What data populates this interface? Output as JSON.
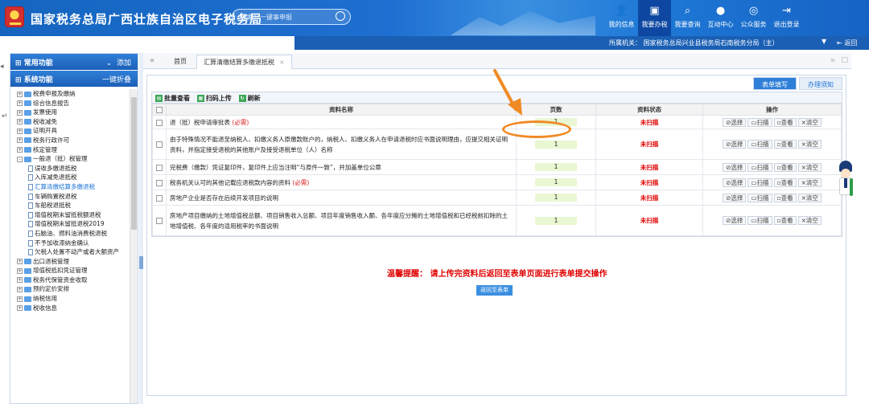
{
  "header": {
    "title": "国家税务总局广西壮族自治区电子税务局",
    "search_placeholder": "搜索：一键事申报",
    "nav": [
      {
        "label": "我的信息",
        "icon": "user-icon"
      },
      {
        "label": "我要办税",
        "icon": "monitor-icon"
      },
      {
        "label": "我要查询",
        "icon": "doc-search-icon"
      },
      {
        "label": "互动中心",
        "icon": "chat-icon"
      },
      {
        "label": "公众服务",
        "icon": "service-icon"
      },
      {
        "label": "退出登录",
        "icon": "logout-icon"
      }
    ]
  },
  "subheader": {
    "org": "所属机关：  国家税务总局兴业县税务局石南税务分局（主）",
    "dropdown": "▼",
    "back": "返回"
  },
  "sidebar": {
    "common": "常用功能",
    "common_add": "添加",
    "system": "系统功能",
    "system_action": "一键折叠",
    "items": [
      {
        "label": "税费申报及缴纳",
        "level": 1,
        "type": "folder",
        "pm": "+"
      },
      {
        "label": "综合信息报告",
        "level": 1,
        "type": "folder",
        "pm": "+"
      },
      {
        "label": "发票使用",
        "level": 1,
        "type": "folder",
        "pm": "+"
      },
      {
        "label": "税收减免",
        "level": 1,
        "type": "folder",
        "pm": "+"
      },
      {
        "label": "证明开具",
        "level": 1,
        "type": "folder",
        "pm": "+"
      },
      {
        "label": "税务行政许可",
        "level": 1,
        "type": "folder",
        "pm": "+"
      },
      {
        "label": "核定管理",
        "level": 1,
        "type": "folder",
        "pm": "+"
      },
      {
        "label": "一般退（抵）税管理",
        "level": 1,
        "type": "folder",
        "pm": "-"
      },
      {
        "label": "误收多缴退抵税",
        "level": 2,
        "type": "page"
      },
      {
        "label": "入库减免退抵税",
        "level": 2,
        "type": "page"
      },
      {
        "label": "汇算清缴结算多缴退税",
        "level": 2,
        "type": "page",
        "selected": true
      },
      {
        "label": "车辆购置税退税",
        "level": 2,
        "type": "page"
      },
      {
        "label": "车船税退抵税",
        "level": 2,
        "type": "page"
      },
      {
        "label": "增值税期末留抵税额退税",
        "level": 2,
        "type": "page"
      },
      {
        "label": "增值税期末留抵退税2019",
        "level": 2,
        "type": "page"
      },
      {
        "label": "石脑油、燃料油消费税退税",
        "level": 2,
        "type": "page"
      },
      {
        "label": "不予加收滞纳金确认",
        "level": 2,
        "type": "page"
      },
      {
        "label": "欠税人处置不动产或者大额资产",
        "level": 2,
        "type": "page"
      },
      {
        "label": "出口退税管理",
        "level": 1,
        "type": "folder",
        "pm": "+"
      },
      {
        "label": "增值税抵扣凭证管理",
        "level": 1,
        "type": "folder",
        "pm": "+"
      },
      {
        "label": "税务代保管资金收取",
        "level": 1,
        "type": "folder",
        "pm": "+"
      },
      {
        "label": "预约定价安排",
        "level": 1,
        "type": "folder",
        "pm": "+"
      },
      {
        "label": "纳税信用",
        "level": 1,
        "type": "folder",
        "pm": "+"
      },
      {
        "label": "税收信息",
        "level": 1,
        "type": "folder",
        "pm": "+"
      }
    ]
  },
  "tabs": {
    "home": "首页",
    "current": "汇算清缴结算多缴退抵税",
    "close": "×"
  },
  "panel_tabs": {
    "fill": "表单填写",
    "notice": "办理须知"
  },
  "toolbar": {
    "batch_view": "批量查看",
    "scan_upload": "扫码上传",
    "refresh": "刷新"
  },
  "table": {
    "headers": {
      "name": "资料名称",
      "pages": "页数",
      "status": "资料状态",
      "op": "操作"
    },
    "op_buttons": {
      "choose": "选择",
      "scan": "扫描",
      "view": "查看",
      "clear": "清空"
    },
    "rows": [
      {
        "name": "退（抵）税申请审批表",
        "required": "(必需)",
        "pages": "1",
        "status": "未扫描"
      },
      {
        "name": "由于特殊情况不能退至纳税人、扣缴义务人原缴款账户的，纳税人、扣缴义务人在申请退税时应书面说明理由，应提交相关证明资料，并指定接受退税的其他账户及接受退税单位（人）名称",
        "required": "",
        "pages": "1",
        "status": "未扫描"
      },
      {
        "name": "完税费（缴款）凭证复印件，复印件上应当注明“与原件一致”，并加盖单位公章",
        "required": "",
        "pages": "1",
        "status": "未扫描"
      },
      {
        "name": "税务机关认可的其他记载应退税款内容的资料",
        "required": "(必需)",
        "pages": "1",
        "status": "未扫描"
      },
      {
        "name": "房地产企业是否存在后续开发项目的说明",
        "required": "",
        "pages": "1",
        "status": "未扫描"
      },
      {
        "name": "房地产项目缴纳的土地增值税总额、项目销售收入总额、项目年度销售收入额、各年度应分摊的土地增值税和已经税前扣除的土地增值税、各年度的适用税率的书面说明",
        "required": "",
        "pages": "1",
        "status": "未扫描"
      }
    ]
  },
  "tip": "温馨提醒：  请上传完资料后返回至表单页面进行表单提交操作",
  "return_button": "返回至表单",
  "colors": {
    "brand": "#1e6fd1",
    "status_red": "#e00000",
    "highlight": "#f08a24"
  }
}
